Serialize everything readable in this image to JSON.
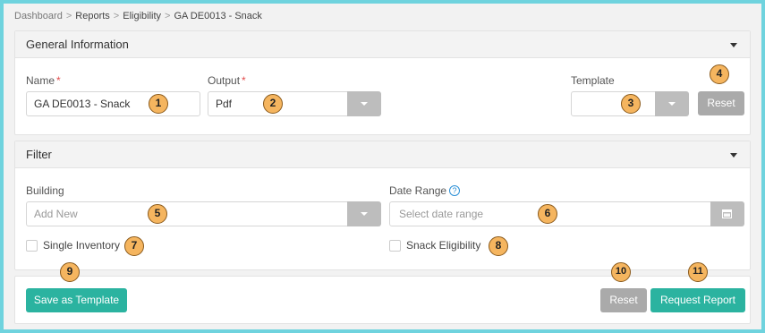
{
  "breadcrumb": [
    "Dashboard",
    "Reports",
    "Eligibility",
    "GA DE0013 - Snack"
  ],
  "general": {
    "title": "General Information",
    "name_label": "Name",
    "name_value": "GA DE0013 - Snack",
    "output_label": "Output",
    "output_value": "Pdf",
    "template_label": "Template",
    "template_value": "",
    "reset_label": "Reset",
    "required_mark": "*"
  },
  "filter": {
    "title": "Filter",
    "building_label": "Building",
    "building_placeholder": "Add New",
    "date_range_label": "Date Range",
    "date_range_placeholder": "Select date range",
    "help_glyph": "?",
    "single_inventory_label": "Single Inventory",
    "single_inventory_checked": false,
    "snack_eligibility_label": "Snack Eligibility",
    "snack_eligibility_checked": false
  },
  "footer": {
    "save_template_label": "Save as Template",
    "reset_label": "Reset",
    "request_report_label": "Request Report"
  },
  "callouts": [
    "1",
    "2",
    "3",
    "4",
    "5",
    "6",
    "7",
    "8",
    "9",
    "10",
    "11"
  ],
  "colors": {
    "frame_border": "#6fd3de",
    "teal_button": "#2bb3a0",
    "gray_button": "#aaaaaa",
    "callout_fill": "#f5b55f",
    "required": "#e24c4c"
  },
  "icons": [
    "chevron-down-icon",
    "calendar-icon",
    "help-icon"
  ]
}
